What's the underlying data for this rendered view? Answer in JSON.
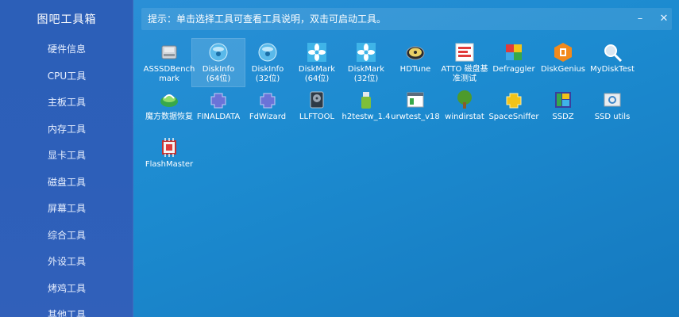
{
  "app": {
    "title": "图吧工具箱"
  },
  "sidebar": {
    "items": [
      {
        "label": "硬件信息"
      },
      {
        "label": "CPU工具"
      },
      {
        "label": "主板工具"
      },
      {
        "label": "内存工具"
      },
      {
        "label": "显卡工具"
      },
      {
        "label": "磁盘工具"
      },
      {
        "label": "屏幕工具"
      },
      {
        "label": "综合工具"
      },
      {
        "label": "外设工具"
      },
      {
        "label": "烤鸡工具"
      },
      {
        "label": "其他工具"
      }
    ]
  },
  "hint": {
    "text": "提示：单击选择工具可查看工具说明，双击可启动工具。",
    "minimize": "–",
    "close": "✕"
  },
  "tools": [
    {
      "label": "ASSSDBench\nmark",
      "icon": "drive-icon"
    },
    {
      "label": "DiskInfo\n(64位)",
      "icon": "disk-sphere-icon"
    },
    {
      "label": "DiskInfo\n(32位)",
      "icon": "disk-sphere-icon"
    },
    {
      "label": "DiskMark\n(64位)",
      "icon": "flower-icon"
    },
    {
      "label": "DiskMark\n(32位)",
      "icon": "flower-icon"
    },
    {
      "label": "HDTune",
      "icon": "harddisk-icon"
    },
    {
      "label": "ATTO 磁盘基\n准测试",
      "icon": "atto-icon"
    },
    {
      "label": "Defraggler",
      "icon": "cubes-icon"
    },
    {
      "label": "DiskGenius",
      "icon": "diskgenius-icon"
    },
    {
      "label": "MyDiskTest",
      "icon": "magnifier-icon"
    },
    {
      "label": "魔方数据恢复",
      "icon": "recovery-icon"
    },
    {
      "label": "FINALDATA",
      "icon": "puzzle-icon"
    },
    {
      "label": "FdWizard",
      "icon": "puzzle-icon"
    },
    {
      "label": "LLFTOOL",
      "icon": "hdd-box-icon"
    },
    {
      "label": "h2testw_1.4",
      "icon": "usb-icon"
    },
    {
      "label": "urwtest_v18",
      "icon": "window-icon"
    },
    {
      "label": "windirstat",
      "icon": "tree-icon"
    },
    {
      "label": "SpaceSniffer",
      "icon": "puzzle-yellow-icon"
    },
    {
      "label": "SSDZ",
      "icon": "ssdz-icon"
    },
    {
      "label": "SSD utils",
      "icon": "ssd-utils-icon"
    },
    {
      "label": "FlashMaster",
      "icon": "chip-icon"
    }
  ],
  "colors": {
    "sidebar": "#2c5fb8",
    "main": "#1c8bd0",
    "accent_red": "#e03b3b",
    "accent_yellow": "#f2c318",
    "accent_cyan": "#3fb4e8",
    "accent_green": "#37a84a"
  }
}
